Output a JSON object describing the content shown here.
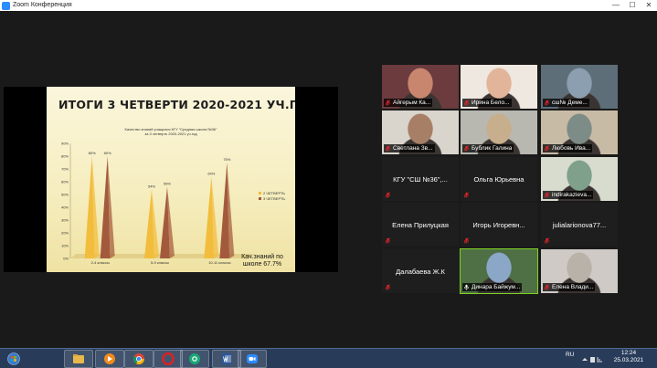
{
  "window": {
    "title": "Zoom Конференция",
    "min_glyph": "—",
    "max_glyph": "☐",
    "close_glyph": "✕"
  },
  "slide": {
    "title": "ИТОГИ 3 ЧЕТВЕРТИ 2020-2021 УЧ.ГОД",
    "subtitle_line1": "Качество знаний учащихся КГУ \"Средняя школа №36\"",
    "subtitle_line2": "за 3 четверть 2020-2021 уч.год",
    "note": "Кач.знаний по школе 67.7%"
  },
  "chart_data": {
    "type": "bar",
    "categories": [
      "2-4 классы",
      "5-9 классы",
      "10-11 классы"
    ],
    "series": [
      {
        "name": "2 ЧЕТВЕРТЬ",
        "values": [
          80,
          54,
          64
        ],
        "color": "#f2bd3c"
      },
      {
        "name": "3 ЧЕТВЕРТЬ",
        "values": [
          80,
          56,
          75
        ],
        "color": "#a35a3c"
      }
    ],
    "data_labels": [
      [
        "80%",
        "54%",
        "64%"
      ],
      [
        "80%",
        "56%",
        "75%"
      ]
    ],
    "y_ticks": [
      "0%",
      "10%",
      "20%",
      "30%",
      "40%",
      "50%",
      "60%",
      "70%",
      "80%",
      "90%"
    ],
    "ylim": [
      0,
      90
    ],
    "legend_position": "right",
    "grid": false
  },
  "participants": [
    {
      "name": "Айгерым Ка...",
      "video": true,
      "muted": true
    },
    {
      "name": "Ирина Бело...",
      "video": true,
      "muted": true
    },
    {
      "name": "сш№ Деме...",
      "video": true,
      "muted": true
    },
    {
      "name": "Светлана Зв...",
      "video": true,
      "muted": true
    },
    {
      "name": "Бублик Галина",
      "video": true,
      "muted": true
    },
    {
      "name": "Любовь Ива...",
      "video": true,
      "muted": true
    },
    {
      "name": "КГУ \"СШ №36\",...",
      "video": false,
      "muted": true
    },
    {
      "name": "Ольга Юрьевна",
      "video": false,
      "muted": true
    },
    {
      "name": "indirakazievа...",
      "video": true,
      "muted": true
    },
    {
      "name": "Елена Прилуцкая",
      "video": false,
      "muted": true
    },
    {
      "name": "Игорь Игоревн...",
      "video": false,
      "muted": true
    },
    {
      "name": "julialarionova77...",
      "video": false,
      "muted": true
    },
    {
      "name": "Далабаева Ж.К",
      "video": false,
      "muted": true
    },
    {
      "name": "Динара Байжум...",
      "video": true,
      "muted": false,
      "speaking": true
    },
    {
      "name": "Елена Влади...",
      "video": true,
      "muted": true
    }
  ],
  "taskbar": {
    "icons": [
      "start-orb-icon",
      "explorer-icon",
      "media-player-icon",
      "chrome-icon",
      "opera-icon",
      "mail-icon",
      "word-icon",
      "zoom-icon"
    ],
    "language": "RU",
    "time": "12:24",
    "date": "25.03.2021"
  },
  "colors": {
    "muted_mic": "#e8262a",
    "active_speaker": "#7ed321",
    "taskbar": "#283c5a"
  }
}
